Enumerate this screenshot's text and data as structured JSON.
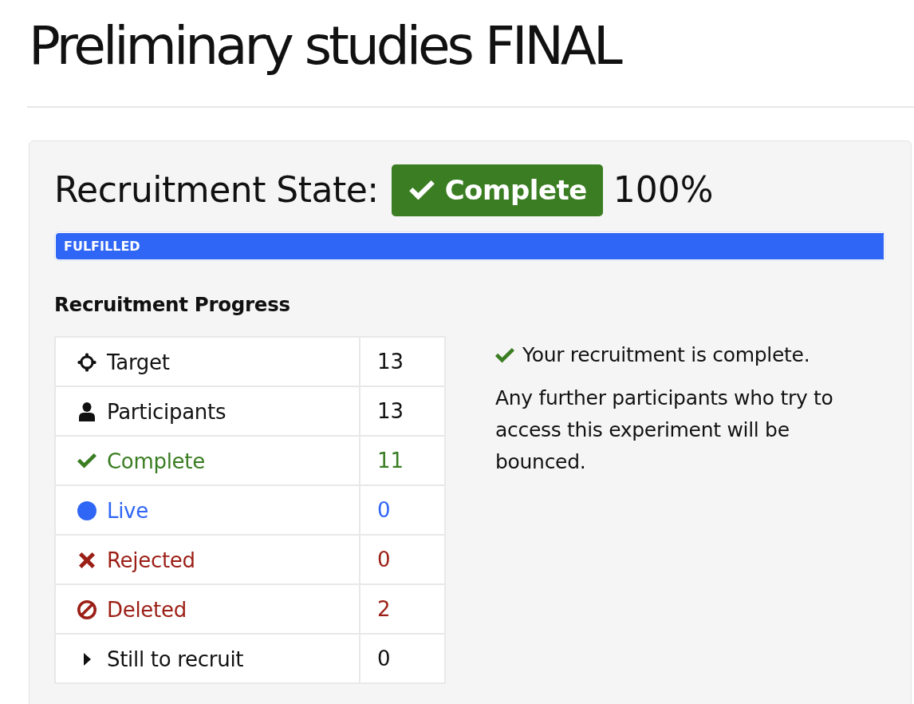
{
  "title": "Preliminary studies FINAL",
  "recruitment_state": {
    "label": "Recruitment State:",
    "badge": {
      "kind": "complete",
      "text": "Complete"
    },
    "percentage": "100%"
  },
  "progress": {
    "label": "FULFILLED",
    "level": 1
  },
  "progress_table": {
    "heading": "Recruitment Progress",
    "rows": [
      {
        "kind": "target",
        "label": "Target",
        "count": "13",
        "color": "#111111"
      },
      {
        "kind": "participants",
        "label": "Participants",
        "count": "13",
        "color": "#111111"
      },
      {
        "kind": "complete",
        "label": "Complete",
        "count": "11",
        "color": "#3a7d22"
      },
      {
        "kind": "live",
        "label": "Live",
        "count": "0",
        "color": "#2f66f5"
      },
      {
        "kind": "rejected",
        "label": "Rejected",
        "count": "0",
        "color": "#9b1f16"
      },
      {
        "kind": "deleted",
        "label": "Deleted",
        "count": "2",
        "color": "#9b1f16"
      },
      {
        "kind": "remaining",
        "label": "Still to recruit",
        "count": "0",
        "color": "#111111"
      }
    ]
  },
  "message": {
    "kind": "complete",
    "headline": "Your recruitment is complete.",
    "body": "Any further participants who try to access this experiment will be bounced."
  }
}
